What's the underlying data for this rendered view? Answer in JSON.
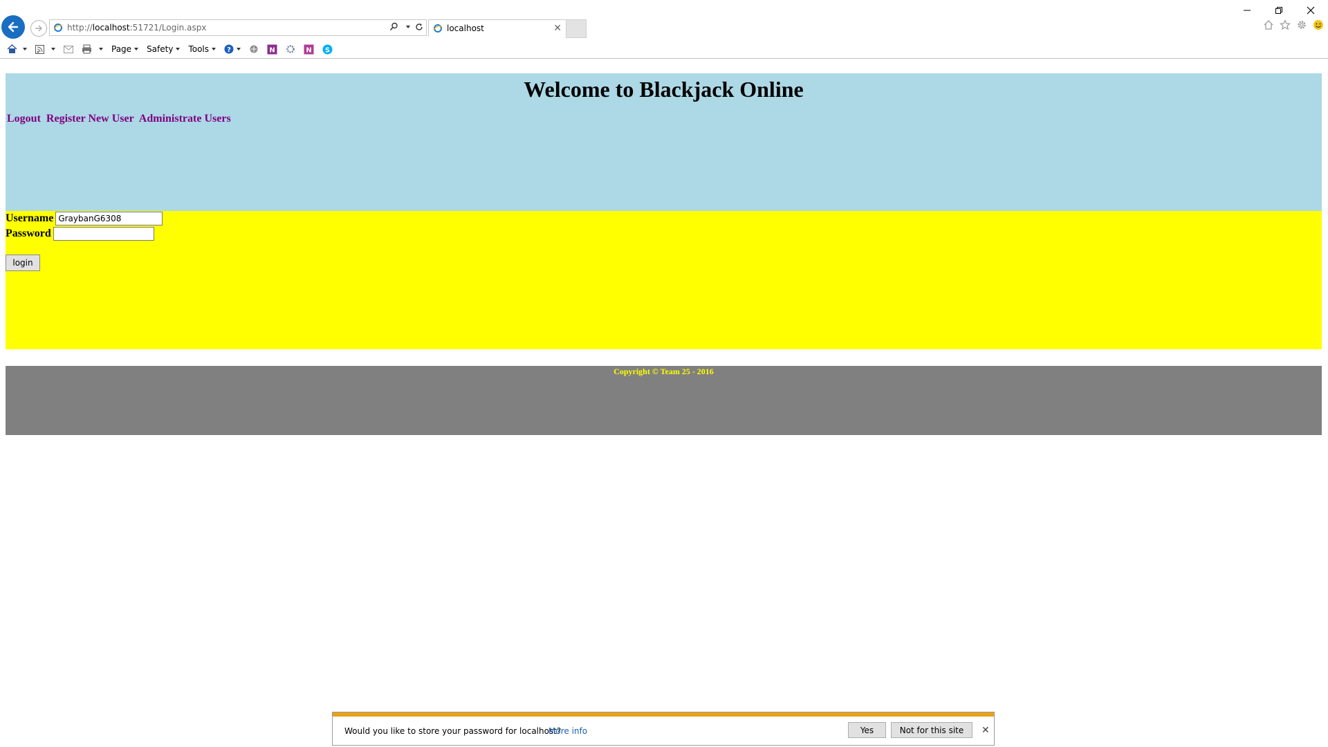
{
  "browser": {
    "url_prefix": "http://",
    "url_host": "localhost",
    "url_rest": ":51721/Login.aspx",
    "tab_title": "localhost",
    "command_bar": {
      "page": "Page",
      "safety": "Safety",
      "tools": "Tools"
    },
    "accent_color": "#1a6ec1"
  },
  "page": {
    "title": "Welcome to Blackjack Online",
    "nav": {
      "logout": "Logout",
      "register": "Register New User",
      "administrate": "Administrate Users"
    },
    "form": {
      "username_label": "Username",
      "username_value": "GraybanG6308",
      "password_label": "Password",
      "password_value": "",
      "login_button": "login"
    },
    "footer": "Copyright © Team 25 - 2016",
    "colors": {
      "header": "#add8e6",
      "login_band": "#ffff00",
      "footer": "#808080",
      "link": "#800080"
    }
  },
  "notification": {
    "message": "Would you like to store your password for localhost?",
    "more_info": "More info",
    "yes": "Yes",
    "not_for_site": "Not for this site",
    "accent": "#e5a31a"
  }
}
